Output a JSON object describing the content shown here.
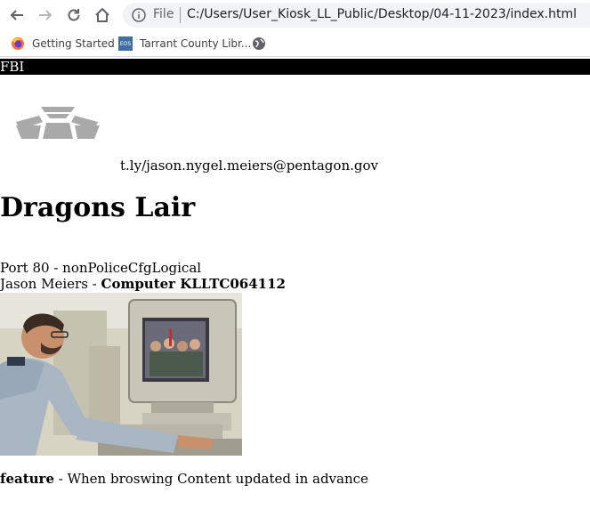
{
  "browser": {
    "url_scheme": "File",
    "url": "C:/Users/User_Kiosk_LL_Public/Desktop/04-11-2023/index.html",
    "nav_icons": [
      "back-arrow-icon",
      "forward-arrow-icon",
      "reload-icon",
      "home-icon",
      "info-icon"
    ]
  },
  "bookmarks": [
    {
      "label": "Getting Started",
      "icon": "firefox-icon"
    },
    {
      "label": "Tarrant County Libr...",
      "icon": "eos-icon",
      "icon_text": "EOS"
    },
    {
      "label": "",
      "icon": "globe-icon"
    }
  ],
  "page": {
    "header_bar": "FBI",
    "email": "t.ly/jason.nygel.meiers@pentagon.gov",
    "title": "Dragons Lair",
    "port_line": "Port 80 - nonPoliceCfgLogical",
    "author_name": "Jason Meiers - ",
    "author_computer": "Computer KLLTC064112",
    "feature_label": "feature",
    "feature_text": " - When broswing Content updated in advance"
  },
  "colors": {
    "header_bar_bg": "#000000",
    "omnibox_bg": "#f1f3f4",
    "logo_gray": "#a9a9a9"
  }
}
